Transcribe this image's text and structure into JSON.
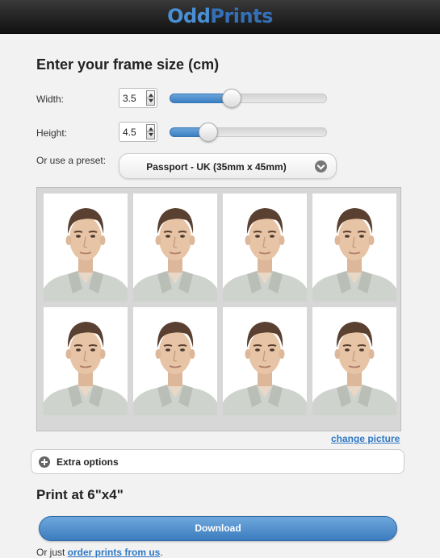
{
  "header": {
    "logo_part1": "Odd",
    "logo_part2": "Prints"
  },
  "frame": {
    "heading": "Enter your frame size (cm)",
    "width_label": "Width:",
    "width_value": "3.5",
    "width_slider_fraction": 0.39,
    "height_label": "Height:",
    "height_value": "4.5",
    "height_slider_fraction": 0.24,
    "preset_label": "Or use a preset:",
    "preset_value": "Passport - UK (35mm x 45mm)"
  },
  "preview": {
    "photo_count": 8,
    "change_picture": "change picture"
  },
  "extra_options": {
    "label": "Extra options"
  },
  "print": {
    "title": "Print at 6\"x4\"",
    "download_label": "Download",
    "footer_prefix": "Or just ",
    "footer_link": "order prints from us",
    "footer_suffix": "."
  },
  "colors": {
    "accent": "#3a7fc2",
    "link": "#2f78c4",
    "header_bg": "#1e1e1e"
  }
}
